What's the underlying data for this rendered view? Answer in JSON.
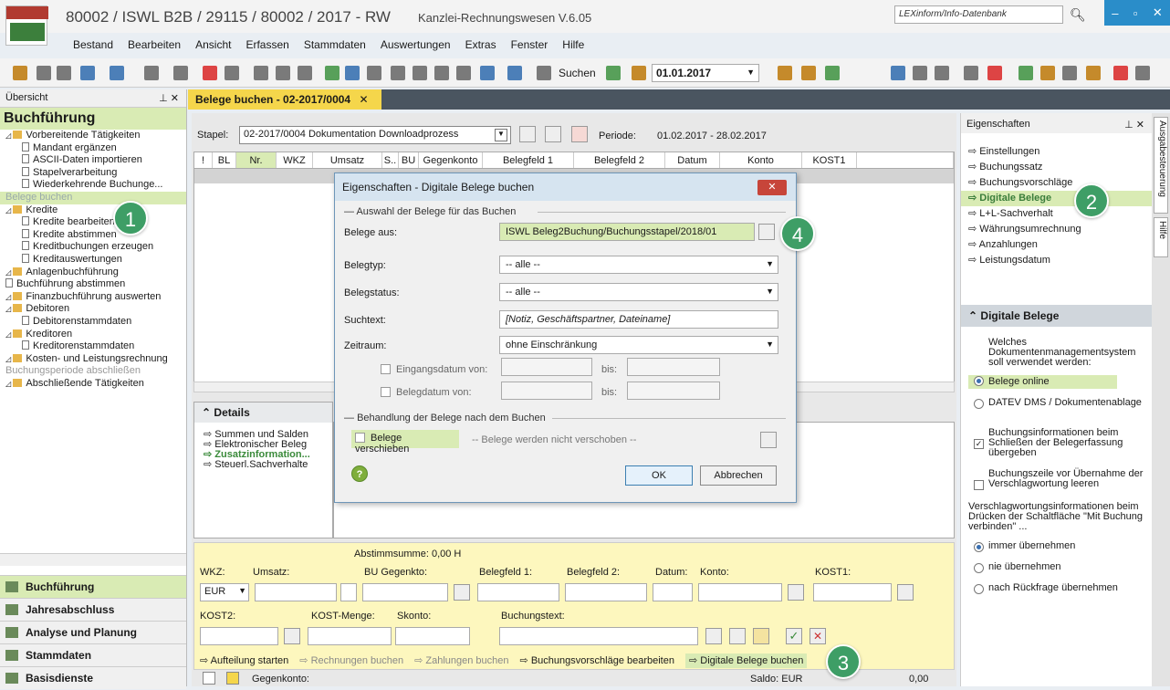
{
  "window": {
    "title": "80002 / ISWL B2B / 29115 / 80002 / 2017 - RW",
    "subtitle": "Kanzlei-Rechnungswesen V.6.05",
    "search_placeholder": "LEXinform/Info-Datenbank"
  },
  "menu": [
    "Bestand",
    "Bearbeiten",
    "Ansicht",
    "Erfassen",
    "Stammdaten",
    "Auswertungen",
    "Extras",
    "Fenster",
    "Hilfe"
  ],
  "toolbar": {
    "search_label": "Suchen",
    "date": "01.01.2017"
  },
  "left": {
    "header": "Übersicht",
    "section": "Buchführung",
    "tree": [
      {
        "label": "Vorbereitende Tätigkeiten",
        "type": "folder",
        "indent": 0
      },
      {
        "label": "Mandant ergänzen",
        "type": "doc",
        "indent": 1
      },
      {
        "label": "ASCII-Daten importieren",
        "type": "doc",
        "indent": 1
      },
      {
        "label": "Stapelverarbeitung",
        "type": "doc",
        "indent": 1
      },
      {
        "label": "Wiederkehrende Buchunge...",
        "type": "doc",
        "indent": 1
      },
      {
        "label": "Belege buchen",
        "type": "plain",
        "indent": 0,
        "selected": true
      },
      {
        "label": "Kredite",
        "type": "folder",
        "indent": 0
      },
      {
        "label": "Kredite bearbeiten",
        "type": "doc",
        "indent": 1
      },
      {
        "label": "Kredite abstimmen",
        "type": "doc",
        "indent": 1
      },
      {
        "label": "Kreditbuchungen erzeugen",
        "type": "doc",
        "indent": 1
      },
      {
        "label": "Kreditauswertungen",
        "type": "doc",
        "indent": 1
      },
      {
        "label": "Anlagenbuchführung",
        "type": "folder",
        "indent": 0
      },
      {
        "label": "Buchführung abstimmen",
        "type": "doc",
        "indent": 0
      },
      {
        "label": "Finanzbuchführung auswerten",
        "type": "folder",
        "indent": 0
      },
      {
        "label": "Debitoren",
        "type": "folder",
        "indent": 0
      },
      {
        "label": "Debitorenstammdaten",
        "type": "doc",
        "indent": 1
      },
      {
        "label": "Kreditoren",
        "type": "folder",
        "indent": 0
      },
      {
        "label": "Kreditorenstammdaten",
        "type": "doc",
        "indent": 1
      },
      {
        "label": "Kosten- und Leistungsrechnung",
        "type": "folder",
        "indent": 0
      },
      {
        "label": "Buchungsperiode abschließen",
        "type": "plain",
        "indent": 0,
        "grey": true
      },
      {
        "label": "Abschließende Tätigkeiten",
        "type": "folder",
        "indent": 0
      }
    ],
    "nav": [
      "Buchführung",
      "Jahresabschluss",
      "Analyse und Planung",
      "Stammdaten",
      "Basisdienste"
    ]
  },
  "tab": {
    "label": "Belege buchen - 02-2017/0004"
  },
  "stapel": {
    "label": "Stapel:",
    "value": "02-2017/0004  Dokumentation Downloadprozess",
    "periode_label": "Periode:",
    "periode": "01.02.2017 - 28.02.2017"
  },
  "grid": {
    "columns": [
      "!",
      "BL",
      "Nr.",
      "WKZ",
      "Umsatz",
      "S..",
      "BU",
      "Gegenkonto",
      "Belegfeld 1",
      "Belegfeld 2",
      "Datum",
      "Konto",
      "KOST1"
    ]
  },
  "details": {
    "title": "Details",
    "items": [
      "Summen und Salden",
      "Elektronischer Beleg",
      "Zusatzinformation...",
      "Steuerl.Sachverhalte"
    ]
  },
  "entry": {
    "abstimmsumme": "Abstimmsumme: 0,00 H",
    "labels1": [
      "WKZ:",
      "Umsatz:",
      "BU Gegenkto:",
      "Belegfeld 1:",
      "Belegfeld 2:",
      "Datum:",
      "Konto:",
      "KOST1:"
    ],
    "wkz": "EUR",
    "labels2": [
      "KOST2:",
      "KOST-Menge:",
      "Skonto:",
      "Buchungstext:"
    ],
    "actions": [
      "Aufteilung starten",
      "Rechnungen buchen",
      "Zahlungen buchen",
      "Buchungsvorschläge bearbeiten",
      "Digitale Belege buchen"
    ]
  },
  "status": {
    "gegenkonto": "Gegenkonto:",
    "saldo": "Saldo: EUR",
    "saldo_value": "0,00"
  },
  "right": {
    "header": "Eigenschaften",
    "items": [
      "Einstellungen",
      "Buchungssatz",
      "Buchungsvorschläge",
      "Digitale Belege",
      "L+L-Sachverhalt",
      "Währungsumrechnung",
      "Anzahlungen",
      "Leistungsdatum"
    ],
    "box_title": "Digitale Belege",
    "question": "Welches Dokumentenmanagementsystem soll verwendet werden:",
    "opt1": "Belege online",
    "opt2": "DATEV DMS / Dokumentenablage",
    "chk1": "Buchungsinformationen beim Schließen der Belegerfassung übergeben",
    "chk2": "Buchungszeile vor Übernahme der Verschlagwortung leeren",
    "question2": "Verschlagwortungsinformationen beim Drücken der Schaltfläche \"Mit Buchung verbinden\" ...",
    "r1": "immer übernehmen",
    "r2": "nie übernehmen",
    "r3": "nach Rückfrage übernehmen"
  },
  "sidetabs": [
    "Ausgabesteuerung",
    "Hilfe"
  ],
  "dialog": {
    "title": "Eigenschaften - Digitale Belege buchen",
    "group1": "Auswahl der Belege für das Buchen",
    "belege_aus_label": "Belege aus:",
    "belege_aus": "ISWL Beleg2Buchung/Buchungsstapel/2018/01",
    "belegtyp_label": "Belegtyp:",
    "belegtyp": "-- alle --",
    "belegstatus_label": "Belegstatus:",
    "belegstatus": "-- alle --",
    "suchtext_label": "Suchtext:",
    "suchtext": "[Notiz, Geschäftspartner, Dateiname]",
    "zeitraum_label": "Zeitraum:",
    "zeitraum": "ohne Einschränkung",
    "eingang_label": "Eingangsdatum von:",
    "belegdatum_label": "Belegdatum von:",
    "bis": "bis:",
    "group2": "Behandlung der Belege nach dem Buchen",
    "verschieben": "Belege verschieben",
    "verschieben_info": "-- Belege werden nicht verschoben --",
    "ok": "OK",
    "cancel": "Abbrechen"
  },
  "badges": [
    "1",
    "2",
    "3",
    "4"
  ]
}
